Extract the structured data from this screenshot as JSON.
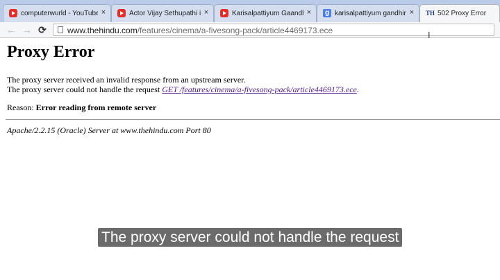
{
  "tabs": [
    {
      "title": "computerwurld - YouTube",
      "icon": "youtube-icon"
    },
    {
      "title": "Actor Vijay Sethupathi is g",
      "icon": "youtube-icon"
    },
    {
      "title": "Karisalpattiyum Gaandhi",
      "icon": "youtube-icon"
    },
    {
      "title": "karisalpattiyum gandhina",
      "icon": "google-icon"
    },
    {
      "title": "502 Proxy Error",
      "icon": "the-hindu-icon",
      "active": true
    }
  ],
  "tab_close": "×",
  "favicon_labels": {
    "google": "g",
    "hindu": "TH"
  },
  "toolbar": {
    "back": "←",
    "forward": "→",
    "reload": "⟳"
  },
  "address_bar": {
    "domain": "www.thehindu.com",
    "path": "/features/cinema/a-fivesong-pack/article4469173.ece"
  },
  "page": {
    "heading": "Proxy Error",
    "line1": "The proxy server received an invalid response from an upstream server.",
    "line2_prefix": "The proxy server could not handle the request ",
    "line2_link": "GET /features/cinema/a-fivesong-pack/article4469173.ece",
    "line2_suffix": ".",
    "reason_label": "Reason: ",
    "reason_text": "Error reading from remote server",
    "server_signature": "Apache/2.2.15 (Oracle) Server at www.thehindu.com Port 80"
  },
  "subtitle": "The proxy server could not handle the request",
  "colors": {
    "tabstrip": "#b9cbe8",
    "link": "#551a8b",
    "subtitle_bg": "#6b6b6b"
  }
}
